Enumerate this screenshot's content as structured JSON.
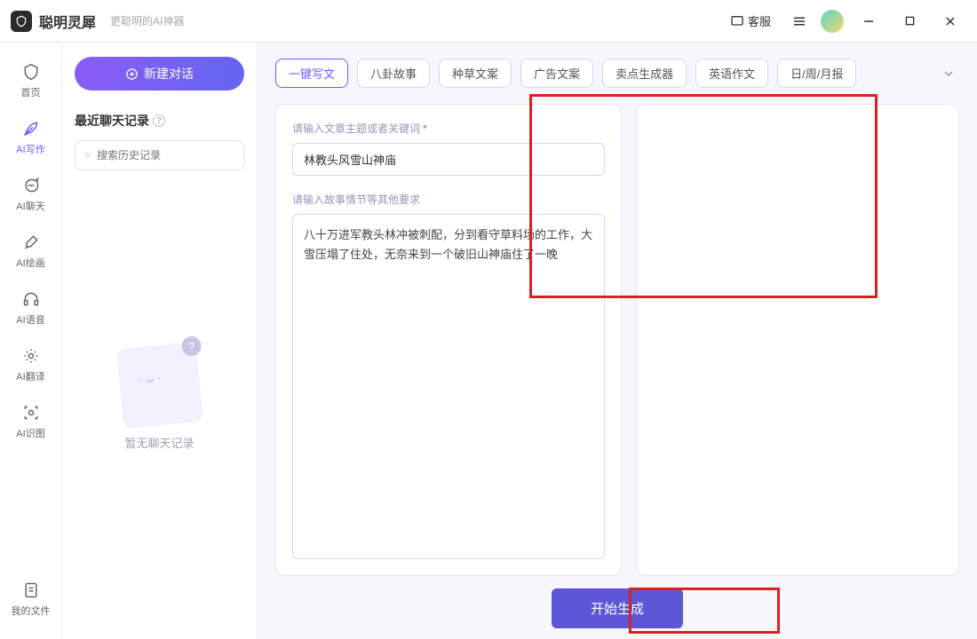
{
  "header": {
    "app_title": "聪明灵犀",
    "tagline": "更聪明的AI神器",
    "customer_service": "客服"
  },
  "sidebar": {
    "items": [
      {
        "label": "首页"
      },
      {
        "label": "AI写作"
      },
      {
        "label": "AI聊天"
      },
      {
        "label": "AI绘画"
      },
      {
        "label": "AI语音"
      },
      {
        "label": "AI翻译"
      },
      {
        "label": "AI识图"
      }
    ],
    "bottom_label": "我的文件"
  },
  "chat_column": {
    "new_chat": "新建对话",
    "section_label": "最近聊天记录",
    "search_placeholder": "搜索历史记录",
    "empty_text": "暂无聊天记录"
  },
  "main": {
    "tabs": [
      {
        "label": "一键写文",
        "active": true
      },
      {
        "label": "八卦故事"
      },
      {
        "label": "种草文案"
      },
      {
        "label": "广告文案"
      },
      {
        "label": "卖点生成器"
      },
      {
        "label": "英语作文"
      },
      {
        "label": "日/周/月报"
      }
    ],
    "form": {
      "topic_label": "请输入文章主题或者关键词",
      "topic_value": "林教头风雪山神庙",
      "details_label": "请输入故事情节等其他要求",
      "details_value": "八十万进军教头林冲被刺配，分到看守草料场的工作，大雪压塌了住处，无奈来到一个破旧山神庙住了一晚"
    },
    "generate_btn": "开始生成"
  }
}
